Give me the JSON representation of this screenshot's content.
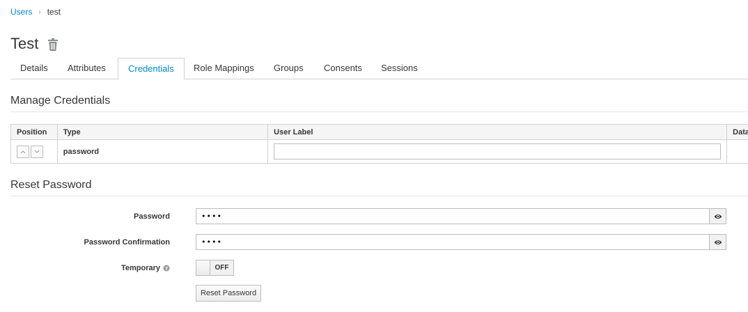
{
  "breadcrumb": {
    "parent": "Users",
    "separator": "›",
    "current": "test"
  },
  "page": {
    "title": "Test"
  },
  "tabs": [
    {
      "label": "Details"
    },
    {
      "label": "Attributes"
    },
    {
      "label": "Credentials",
      "active": true
    },
    {
      "label": "Role Mappings"
    },
    {
      "label": "Groups"
    },
    {
      "label": "Consents"
    },
    {
      "label": "Sessions"
    }
  ],
  "manage_credentials": {
    "title": "Manage Credentials",
    "columns": [
      "Position",
      "Type",
      "User Label",
      "Data"
    ],
    "rows": [
      {
        "type": "password",
        "user_label": ""
      }
    ]
  },
  "reset_password": {
    "title": "Reset Password",
    "password_label": "Password",
    "password_value": "••••",
    "confirmation_label": "Password Confirmation",
    "confirmation_value": "••••",
    "temporary_label": "Temporary",
    "temporary_state": "OFF",
    "button_label": "Reset Password"
  },
  "colors": {
    "link": "#0088ce",
    "border": "#d1d1d1",
    "text": "#363636"
  }
}
